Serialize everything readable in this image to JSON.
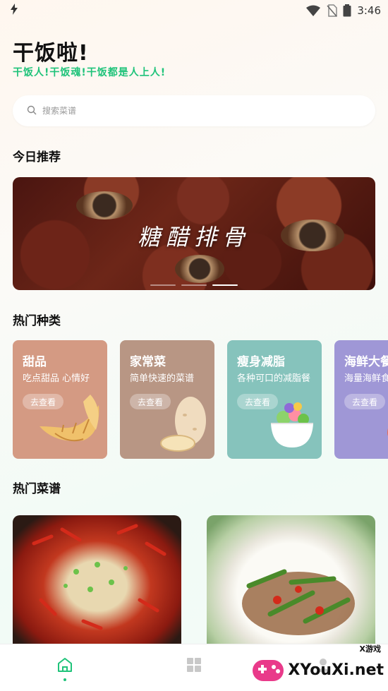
{
  "status": {
    "time": "3:46"
  },
  "header": {
    "title": "干饭啦!",
    "subtitle": "干饭人!干饭魂!干饭都是人上人!"
  },
  "search": {
    "placeholder": "搜索菜谱"
  },
  "sections": {
    "today": "今日推荐",
    "categories": "热门种类",
    "recipes": "热门菜谱"
  },
  "banner": {
    "text": "糖醋排骨",
    "slide_count": 3,
    "active_slide": 3
  },
  "categories": [
    {
      "name": "甜品",
      "desc": "吃点甜品 心情好",
      "button": "去查看",
      "color": "#d49a83",
      "icon": "croissant-icon"
    },
    {
      "name": "家常菜",
      "desc": "简单快速的菜谱",
      "button": "去查看",
      "color": "#b89684",
      "icon": "potato-icon"
    },
    {
      "name": "瘦身减脂",
      "desc": "各种可口的减脂餐",
      "button": "去查看",
      "color": "#86c3bc",
      "icon": "salad-bowl-icon"
    },
    {
      "name": "海鲜大餐",
      "desc": "海量海鲜食谱",
      "button": "去查看",
      "color": "#9f97d6",
      "icon": "shrimp-icon"
    }
  ],
  "tabs": [
    {
      "label": "home",
      "icon": "home-icon",
      "active": true
    },
    {
      "label": "category",
      "icon": "grid-icon",
      "active": false
    },
    {
      "label": "profile",
      "icon": "profile-icon",
      "active": false
    }
  ],
  "watermark": {
    "text": "XYouXi.net",
    "small": "X游戏"
  },
  "colors": {
    "accent": "#1fc37a"
  }
}
